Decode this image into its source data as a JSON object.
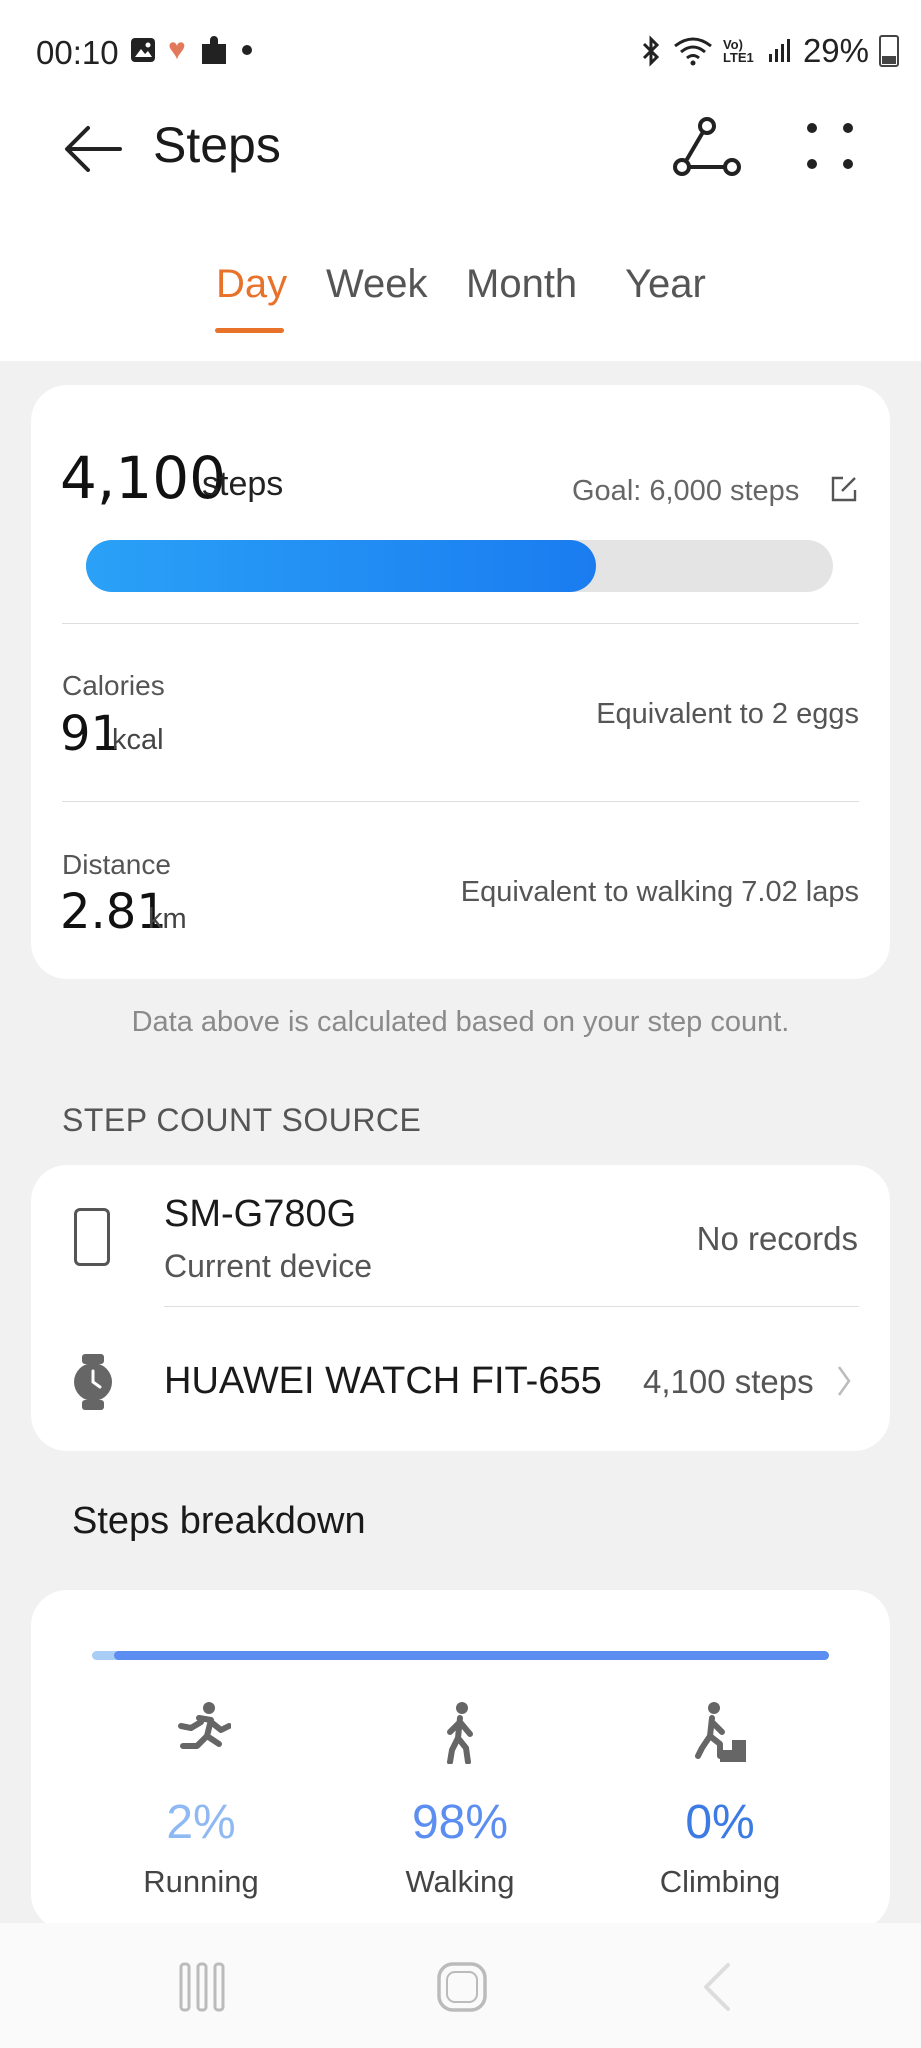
{
  "status_bar": {
    "time": "00:10",
    "battery": "29%",
    "network_label": "Vo) LTE1",
    "icons": [
      "image-icon",
      "heart-icon",
      "puzzle-icon",
      "dot-icon",
      "bluetooth-icon",
      "wifi-icon",
      "volte-icon",
      "signal-icon",
      "battery-icon"
    ]
  },
  "app_bar": {
    "title": "Steps",
    "icons": [
      "back-arrow-icon",
      "route-icon",
      "more-icon"
    ]
  },
  "tabs": [
    {
      "label": "Day",
      "active": true
    },
    {
      "label": "Week",
      "active": false
    },
    {
      "label": "Month",
      "active": false
    },
    {
      "label": "Year",
      "active": false
    }
  ],
  "summary": {
    "steps_value": "4,100",
    "steps_unit": "steps",
    "goal_label": "Goal: 6,000 steps",
    "progress_fraction": 0.683,
    "calories_label": "Calories",
    "calories_value": "91",
    "calories_unit": "kcal",
    "calories_equiv": "Equivalent to 2 eggs",
    "distance_label": "Distance",
    "distance_value": "2.81",
    "distance_unit": "km",
    "distance_equiv": "Equivalent to walking 7.02 laps"
  },
  "note": "Data above is calculated based on your step count.",
  "source": {
    "section_title": "STEP COUNT SOURCE",
    "devices": [
      {
        "name": "SM-G780G",
        "subtitle": "Current device",
        "value": "No records",
        "icon": "phone-icon"
      },
      {
        "name": "HUAWEI WATCH FIT-655",
        "value": "4,100 steps",
        "icon": "watch-icon"
      }
    ]
  },
  "breakdown": {
    "title": "Steps breakdown",
    "items": [
      {
        "label": "Running",
        "percent": "2%",
        "fraction": 0.02,
        "color": "#8fb9f2",
        "icon": "running-icon"
      },
      {
        "label": "Walking",
        "percent": "98%",
        "fraction": 0.98,
        "color": "#5b8ef0",
        "icon": "walking-icon"
      },
      {
        "label": "Climbing",
        "percent": "0%",
        "fraction": 0,
        "color": "#3c7be3",
        "icon": "climbing-icon"
      }
    ]
  },
  "nav_bar": {
    "icons": [
      "recents-icon",
      "home-icon",
      "back-icon"
    ]
  }
}
